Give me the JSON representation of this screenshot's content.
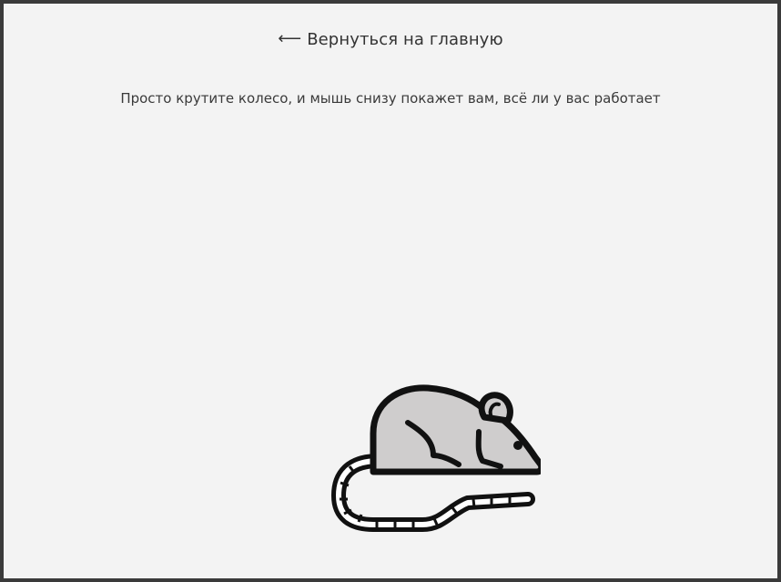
{
  "nav": {
    "back_arrow": "⟵",
    "back_label": "Вернуться на главную",
    "back_icon": "arrow-left-icon"
  },
  "main": {
    "hint_text": "Просто крутите колесо, и мышь снизу покажет вам, всё ли у вас работает",
    "mouse_icon": "mouse-icon"
  },
  "colors": {
    "background": "#f3f3f3",
    "frame": "#3a3a3a",
    "text": "#333333",
    "mouse_body": "#cfcdcd",
    "mouse_outline": "#111111",
    "tail_stripe": "#ffffff"
  }
}
